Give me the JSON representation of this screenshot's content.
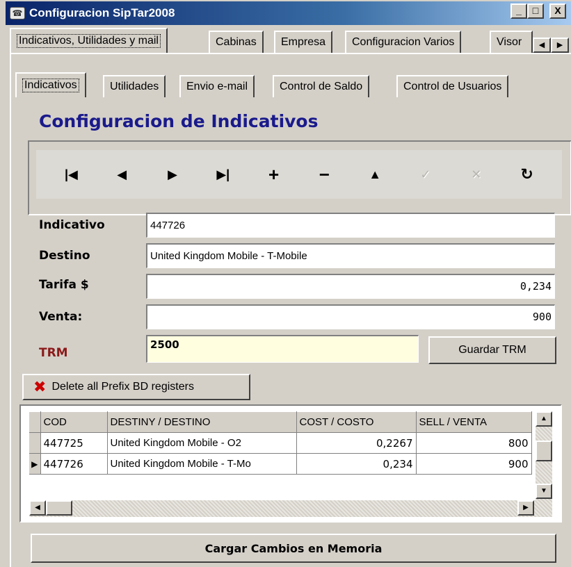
{
  "window": {
    "title": "Configuracion SipTar2008",
    "controls": {
      "minimize": "_",
      "maximize": "□",
      "close": "X"
    }
  },
  "outer_tabs": [
    {
      "label": "Indicativos, Utilidades y mail",
      "active": true
    },
    {
      "label": "Cabinas"
    },
    {
      "label": "Empresa"
    },
    {
      "label": "Configuracion Varios"
    },
    {
      "label": "Visor"
    }
  ],
  "inner_tabs": [
    {
      "label": "Indicativos",
      "active": true
    },
    {
      "label": "Utilidades"
    },
    {
      "label": "Envio e-mail"
    },
    {
      "label": "Control de Saldo"
    },
    {
      "label": "Control de Usuarios"
    }
  ],
  "heading": "Configuracion de Indicativos",
  "navigator": {
    "first_icon": "first-record-icon",
    "prior_icon": "prior-record-icon",
    "next_icon": "next-record-icon",
    "last_icon": "last-record-icon",
    "insert_icon": "insert-record-icon",
    "delete_icon": "delete-record-icon",
    "edit_icon": "edit-record-icon",
    "post_icon": "post-record-icon",
    "cancel_icon": "cancel-record-icon",
    "refresh_icon": "refresh-icon"
  },
  "form": {
    "indicativo_label": "Indicativo",
    "indicativo_value": "447726",
    "destino_label": "Destino",
    "destino_value": "United Kingdom Mobile - T-Mobile",
    "tarifa_label": "Tarifa $",
    "tarifa_value": "0,234",
    "venta_label": "Venta:",
    "venta_value": "900",
    "trm_label": "TRM",
    "trm_value": "2500",
    "guardar_trm": "Guardar TRM"
  },
  "delete_all_label": "Delete all Prefix BD registers",
  "grid": {
    "columns": [
      "COD",
      "DESTINY / DESTINO",
      "COST / COSTO",
      "SELL / VENTA"
    ],
    "rows": [
      {
        "cod": "447725",
        "destino": "United Kingdom Mobile - O2",
        "costo": "0,2267",
        "venta": "800",
        "current": false
      },
      {
        "cod": "447726",
        "destino": "United Kingdom Mobile - T-Mo",
        "costo": "0,234",
        "venta": "900",
        "current": true
      }
    ]
  },
  "load_button": "Cargar Cambios en Memoria",
  "colors": {
    "title_bar": "#0a246a",
    "heading": "#1a1a8c",
    "trm_label": "#8b1a1a",
    "trm_field_bg": "#ffffe0",
    "delete_icon": "#cc0000"
  }
}
